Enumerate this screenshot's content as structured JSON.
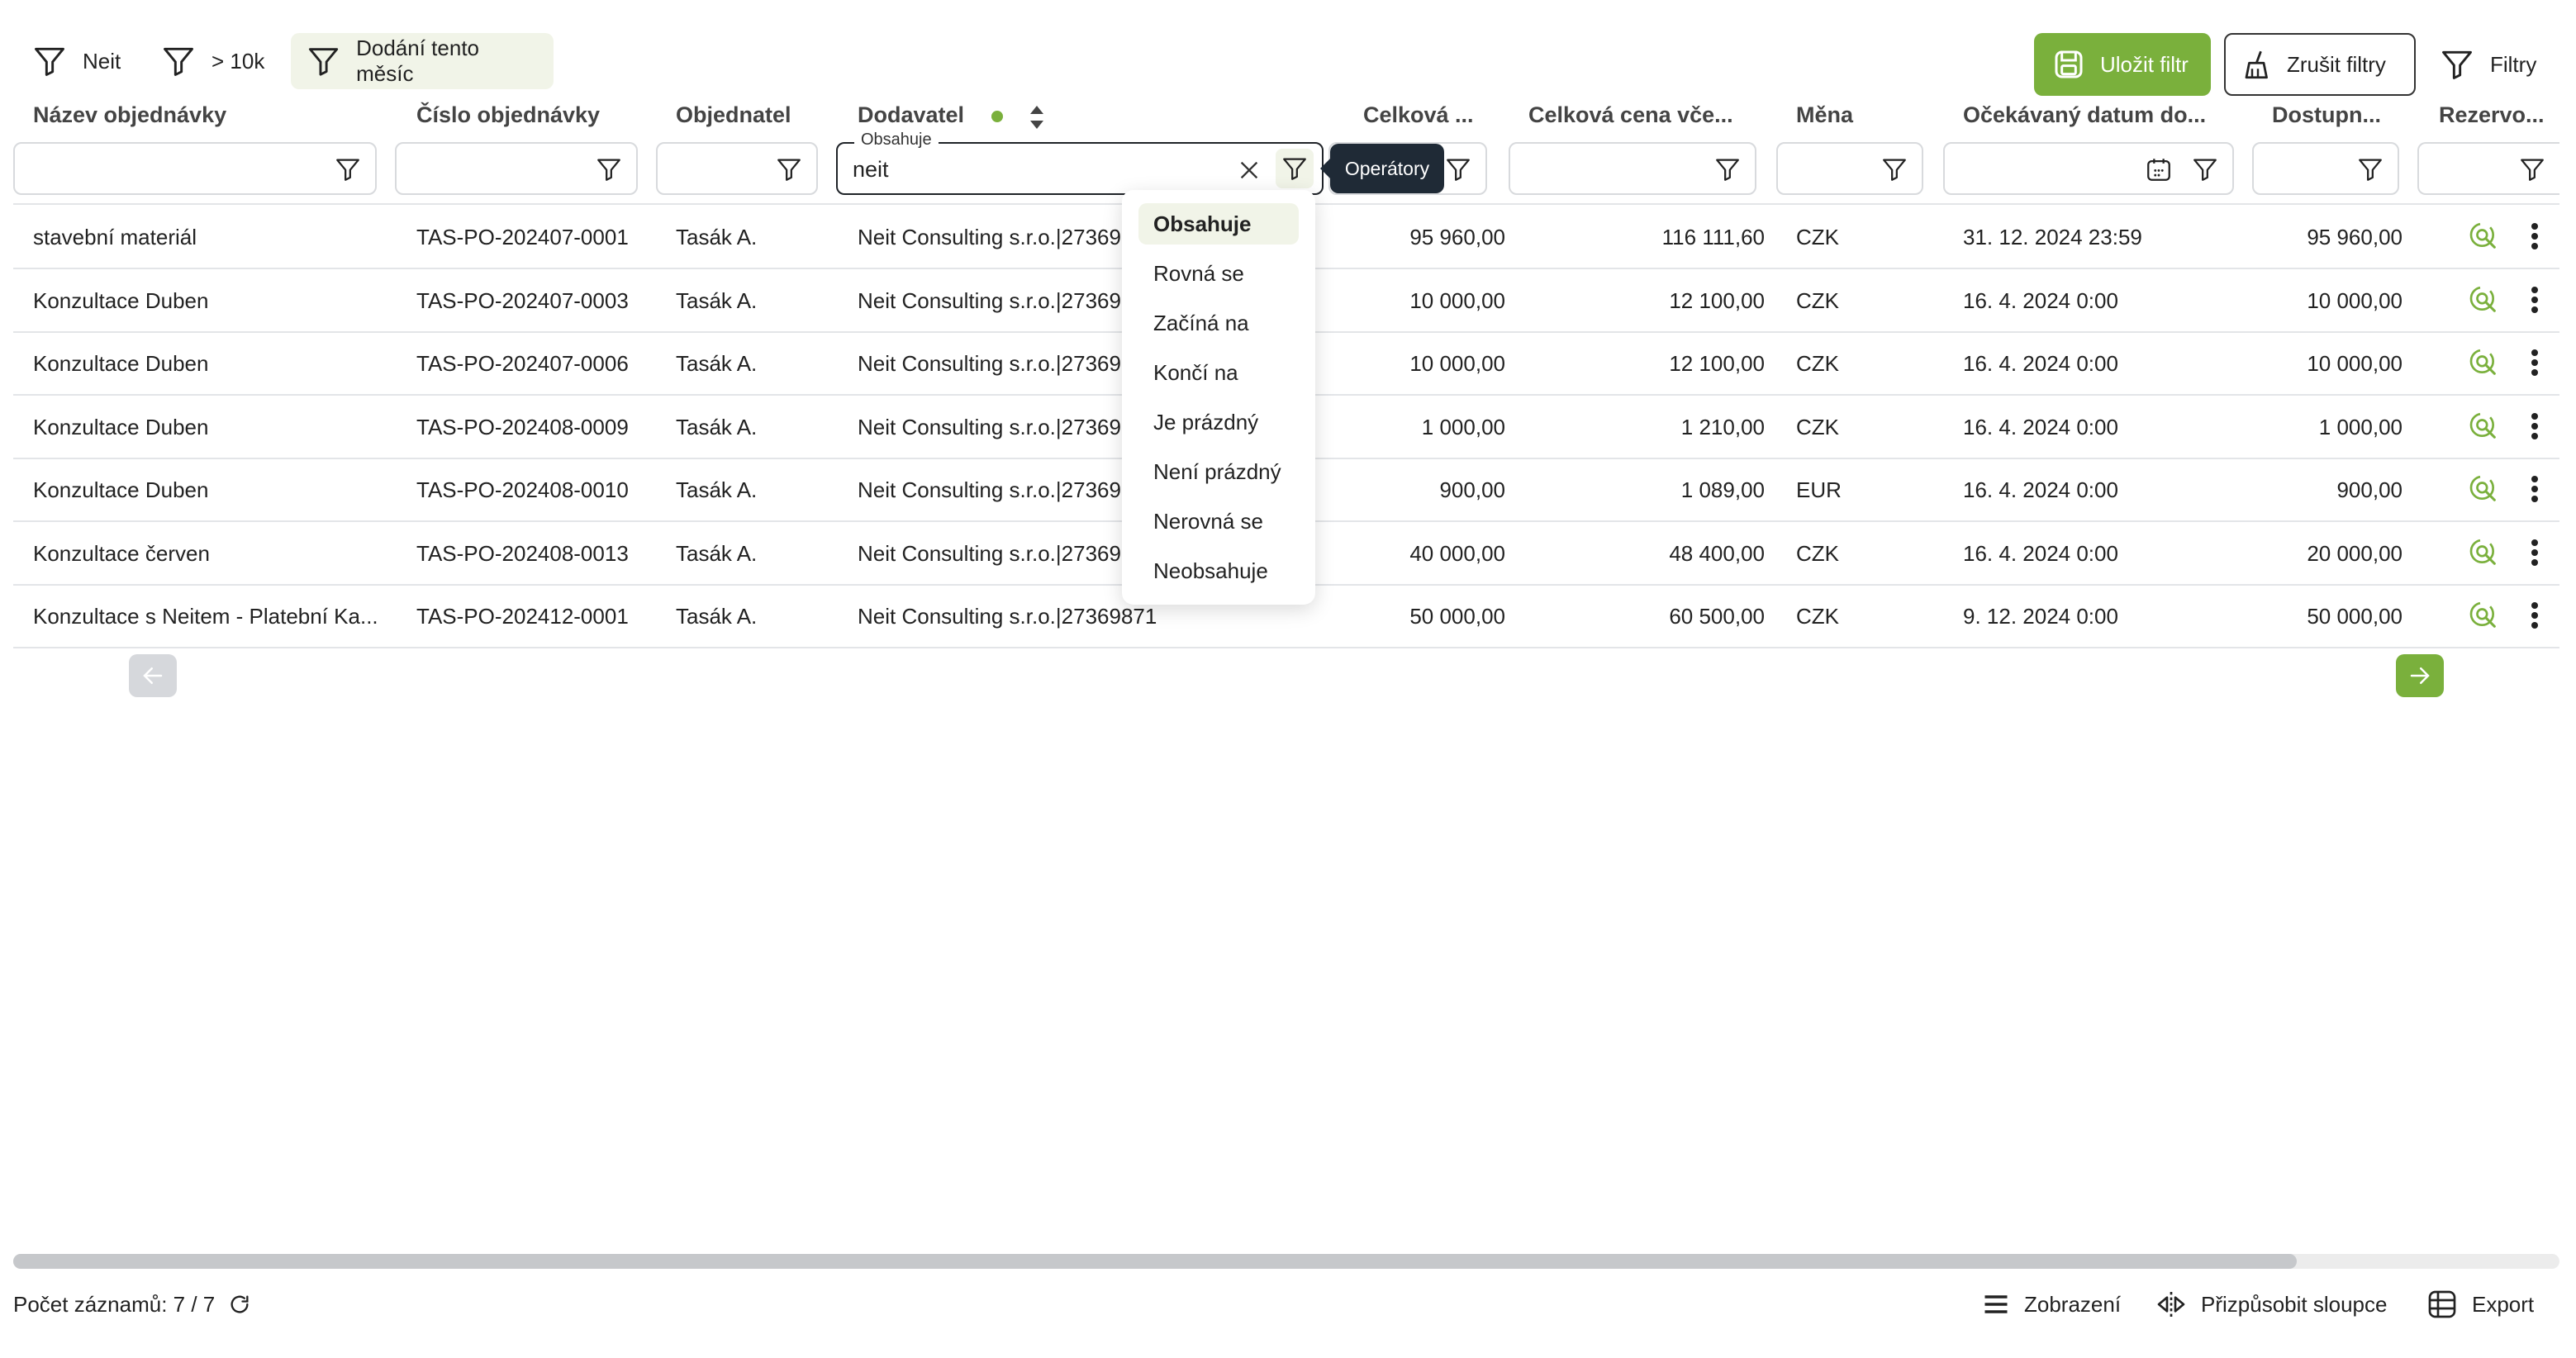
{
  "toolbar": {
    "chips": [
      {
        "label": "Neit",
        "icon": "filter-icon"
      },
      {
        "label": "> 10k",
        "icon": "filter-icon"
      },
      {
        "label": "Dodání tento měsíc",
        "icon": "filter-icon",
        "active": true
      }
    ],
    "save_filter": "Uložit filtr",
    "clear_filters": "Zrušit filtry",
    "filters": "Filtry"
  },
  "columns": [
    "Název objednávky",
    "Číslo objednávky",
    "Objednatel",
    "Dodavatel",
    "Celková ...",
    "Celková cena vče...",
    "Měna",
    "Očekávaný datum do...",
    "Dostupn...",
    "Rezervo..."
  ],
  "supplier_filter": {
    "floating_label": "Obsahuje",
    "value": "neit",
    "tooltip": "Operátory"
  },
  "operators": [
    "Obsahuje",
    "Rovná se",
    "Začíná na",
    "Končí na",
    "Je prázdný",
    "Není prázdný",
    "Nerovná se",
    "Neobsahuje"
  ],
  "selected_operator": "Obsahuje",
  "rows": [
    {
      "name": "stavební materiál",
      "number": "TAS-PO-202407-0001",
      "orderer": "Tasák A.",
      "supplier": "Neit Consulting s.r.o.|27369",
      "total": "95 960,00",
      "total_vat": "116 111,60",
      "currency": "CZK",
      "date": "31. 12. 2024 23:59",
      "available": "95 960,00"
    },
    {
      "name": "Konzultace Duben",
      "number": "TAS-PO-202407-0003",
      "orderer": "Tasák A.",
      "supplier": "Neit Consulting s.r.o.|27369",
      "total": "10 000,00",
      "total_vat": "12 100,00",
      "currency": "CZK",
      "date": "16. 4. 2024 0:00",
      "available": "10 000,00"
    },
    {
      "name": "Konzultace Duben",
      "number": "TAS-PO-202407-0006",
      "orderer": "Tasák A.",
      "supplier": "Neit Consulting s.r.o.|27369",
      "total": "10 000,00",
      "total_vat": "12 100,00",
      "currency": "CZK",
      "date": "16. 4. 2024 0:00",
      "available": "10 000,00"
    },
    {
      "name": "Konzultace Duben",
      "number": "TAS-PO-202408-0009",
      "orderer": "Tasák A.",
      "supplier": "Neit Consulting s.r.o.|27369",
      "total": "1 000,00",
      "total_vat": "1 210,00",
      "currency": "CZK",
      "date": "16. 4. 2024 0:00",
      "available": "1 000,00"
    },
    {
      "name": "Konzultace Duben",
      "number": "TAS-PO-202408-0010",
      "orderer": "Tasák A.",
      "supplier": "Neit Consulting s.r.o.|27369",
      "total": "900,00",
      "total_vat": "1 089,00",
      "currency": "EUR",
      "date": "16. 4. 2024 0:00",
      "available": "900,00"
    },
    {
      "name": "Konzultace červen",
      "number": "TAS-PO-202408-0013",
      "orderer": "Tasák A.",
      "supplier": "Neit Consulting s.r.o.|27369",
      "total": "40 000,00",
      "total_vat": "48 400,00",
      "currency": "CZK",
      "date": "16. 4. 2024 0:00",
      "available": "20 000,00"
    },
    {
      "name": "Konzultace s Neitem - Platební Ka...",
      "number": "TAS-PO-202412-0001",
      "orderer": "Tasák A.",
      "supplier": "Neit Consulting s.r.o.|27369871",
      "total": "50 000,00",
      "total_vat": "60 500,00",
      "currency": "CZK",
      "date": "9. 12. 2024 0:00",
      "available": "50 000,00"
    }
  ],
  "footer": {
    "record_count": "Počet záznamů: 7 / 7",
    "view": "Zobrazení",
    "adjust_columns": "Přizpůsobit sloupce",
    "export": "Export"
  },
  "colors": {
    "accent": "#7ab03c",
    "dark": "#1f2a36"
  }
}
